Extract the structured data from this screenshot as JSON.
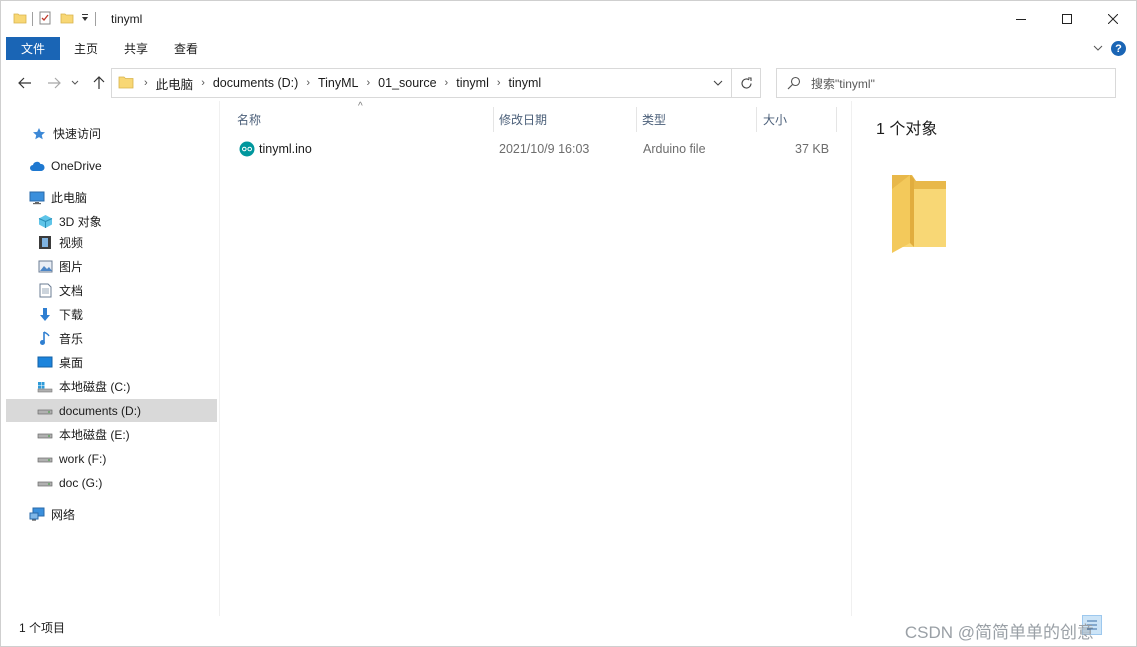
{
  "window": {
    "title": "tinyml"
  },
  "ribbon": {
    "tabs": [
      {
        "label": "文件"
      },
      {
        "label": "主页"
      },
      {
        "label": "共享"
      },
      {
        "label": "查看"
      }
    ]
  },
  "address": {
    "crumbs": [
      "此电脑",
      "documents (D:)",
      "TinyML",
      "01_source",
      "tinyml",
      "tinyml"
    ]
  },
  "search": {
    "placeholder": "搜索\"tinyml\""
  },
  "sidebar": {
    "items": [
      {
        "label": "快速访问",
        "icon": "star-icon"
      },
      {
        "label": "OneDrive",
        "icon": "cloud-icon"
      },
      {
        "label": "此电脑",
        "icon": "computer-icon"
      },
      {
        "label": "3D 对象",
        "icon": "cube-icon"
      },
      {
        "label": "视频",
        "icon": "film-icon"
      },
      {
        "label": "图片",
        "icon": "picture-icon"
      },
      {
        "label": "文档",
        "icon": "document-icon"
      },
      {
        "label": "下载",
        "icon": "download-icon"
      },
      {
        "label": "音乐",
        "icon": "music-icon"
      },
      {
        "label": "桌面",
        "icon": "desktop-icon"
      },
      {
        "label": "本地磁盘 (C:)",
        "icon": "system-drive-icon"
      },
      {
        "label": "documents (D:)",
        "icon": "drive-icon"
      },
      {
        "label": "本地磁盘 (E:)",
        "icon": "drive-icon"
      },
      {
        "label": "work (F:)",
        "icon": "drive-icon"
      },
      {
        "label": "doc (G:)",
        "icon": "drive-icon"
      },
      {
        "label": "网络",
        "icon": "network-icon"
      }
    ],
    "selected": "documents (D:)"
  },
  "filelist": {
    "columns": [
      "名称",
      "修改日期",
      "类型",
      "大小"
    ],
    "rows": [
      {
        "name": "tinyml.ino",
        "modified": "2021/10/9 16:03",
        "type": "Arduino file",
        "size": "37 KB",
        "icon": "arduino-icon"
      }
    ]
  },
  "details": {
    "count_text": "1 个对象"
  },
  "status": {
    "text": "1 个项目"
  },
  "watermark": {
    "text": "CSDN @简简单单的创意"
  },
  "colors": {
    "accent": "#1a65b5",
    "folder": "#f8d775",
    "selection": "#d9d9d9",
    "arduino": "#00979d"
  }
}
